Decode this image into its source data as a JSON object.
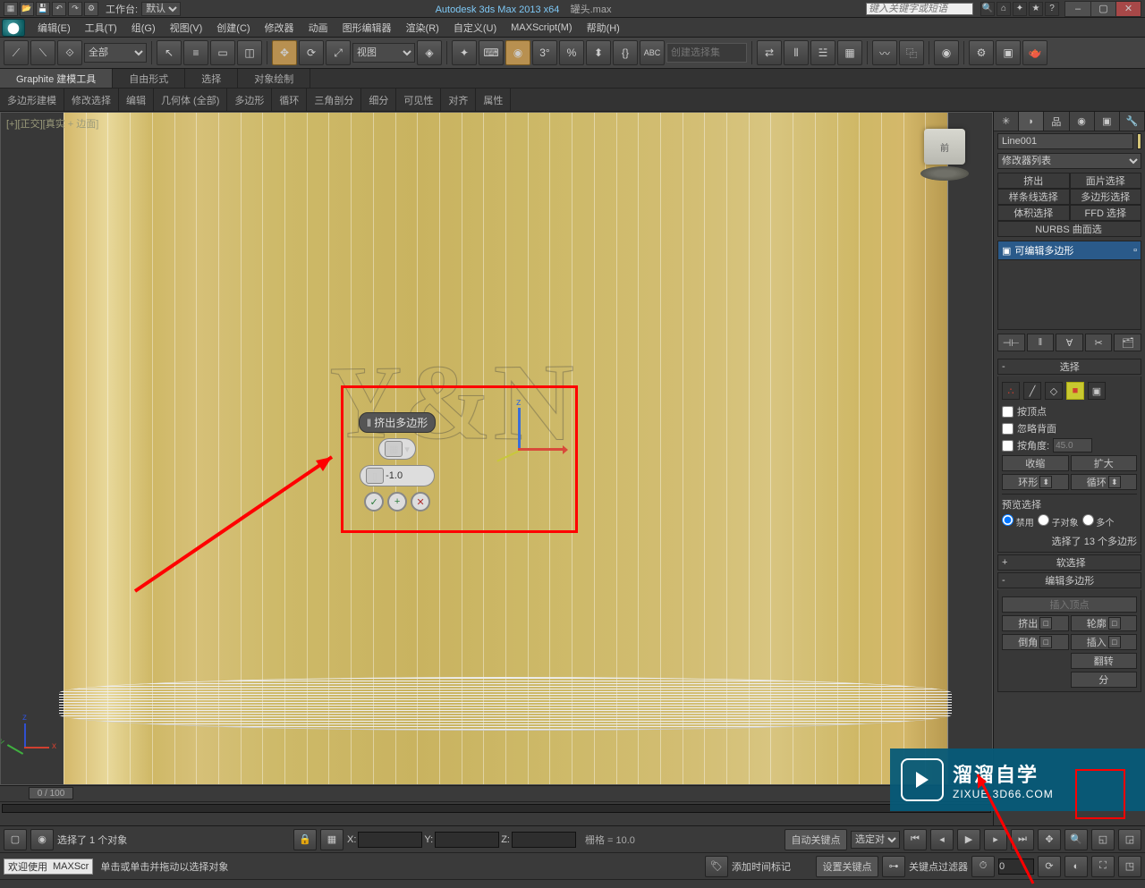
{
  "title_bar": {
    "workspace_label": "工作台:",
    "workspace_value": "默认",
    "app_name": "Autodesk 3ds Max  2013 x64",
    "file_name": "罐头.max",
    "search_placeholder": "键入关键字或短语"
  },
  "menu": {
    "items": [
      "编辑(E)",
      "工具(T)",
      "组(G)",
      "视图(V)",
      "创建(C)",
      "修改器",
      "动画",
      "图形编辑器",
      "渲染(R)",
      "自定义(U)",
      "MAXScript(M)",
      "帮助(H)"
    ]
  },
  "toolbar": {
    "filter_all": "全部",
    "view_dropdown": "视图",
    "selection_set_placeholder": "创建选择集"
  },
  "ribbon": {
    "tabs": [
      "Graphite 建模工具",
      "自由形式",
      "选择",
      "对象绘制"
    ],
    "subtabs": [
      "多边形建模",
      "修改选择",
      "编辑",
      "几何体 (全部)",
      "多边形",
      "循环",
      "三角剖分",
      "细分",
      "可见性",
      "对齐",
      "属性"
    ]
  },
  "viewport": {
    "label": "[+][正交][真实 + 边面]",
    "viewcube_face": "前",
    "text_model": "Y&N"
  },
  "caddy": {
    "title": "‖ 挤出多边形",
    "value": "-1.0"
  },
  "command_panel": {
    "object_name": "Line001",
    "modifier_list": "修改器列表",
    "mod_buttons": [
      "挤出",
      "面片选择",
      "样条线选择",
      "多边形选择",
      "体积选择",
      "FFD 选择",
      "NURBS 曲面选"
    ],
    "stack_item": "可编辑多边形",
    "rollout_selection": "选择",
    "by_vertex": "按顶点",
    "ignore_backfacing": "忽略背面",
    "by_angle": "按角度:",
    "by_angle_value": "45.0",
    "shrink": "收缩",
    "grow": "扩大",
    "ring": "环形",
    "loop": "循环",
    "preview_selection": "预览选择",
    "preview_off": "禁用",
    "preview_subobj": "子对象",
    "preview_multi": "多个",
    "selection_status": "选择了 13 个多边形",
    "rollout_soft": "软选择",
    "rollout_edit_poly": "编辑多边形",
    "insert_vertex": "插入顶点",
    "extrude": "挤出",
    "outline": "轮廓",
    "bevel": "倒角",
    "inset": "插入",
    "flip": "翻转",
    "from_edge": "分"
  },
  "timeline": {
    "scrubber": "0 / 100"
  },
  "status": {
    "selection_info": "选择了 1 个对象",
    "prompt": "单击或单击并拖动以选择对象",
    "x": "",
    "y": "",
    "z": "",
    "grid_label": "栅格 = 10.0",
    "auto_key": "自动关键点",
    "set_key": "设置关键点",
    "selected_dropdown": "选定对",
    "key_filters": "关键点过滤器",
    "add_time_tag": "添加时间标记",
    "welcome": "欢迎使用",
    "maxscript": "MAXScr"
  },
  "watermark": {
    "title": "溜溜自学",
    "url": "ZIXUE.3D66.COM"
  }
}
